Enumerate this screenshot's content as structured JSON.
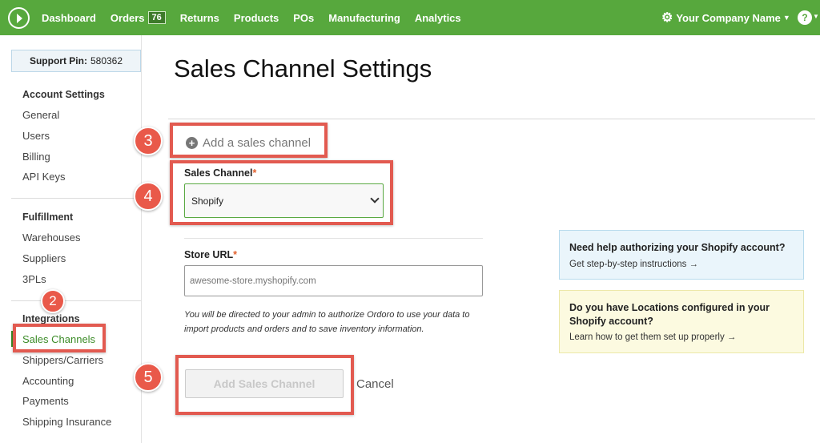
{
  "topbar": {
    "nav": [
      {
        "label": "Dashboard"
      },
      {
        "label": "Orders",
        "badge": "76"
      },
      {
        "label": "Returns"
      },
      {
        "label": "Products"
      },
      {
        "label": "POs"
      },
      {
        "label": "Manufacturing"
      },
      {
        "label": "Analytics"
      }
    ],
    "company": "Your Company Name",
    "help": "?"
  },
  "sidebar": {
    "support_pin_label": "Support Pin:",
    "support_pin_value": "580362",
    "sections": [
      {
        "title": "Account Settings",
        "items": [
          "General",
          "Users",
          "Billing",
          "API Keys"
        ]
      },
      {
        "title": "Fulfillment",
        "items": [
          "Warehouses",
          "Suppliers",
          "3PLs"
        ]
      },
      {
        "title": "Integrations",
        "items": [
          "Sales Channels",
          "Shippers/Carriers",
          "Accounting",
          "Payments",
          "Shipping Insurance"
        ]
      }
    ],
    "active_item": "Sales Channels"
  },
  "main": {
    "title": "Sales Channel Settings",
    "add_channel": "Add a sales channel",
    "sales_channel_label": "Sales Channel",
    "sales_channel_value": "Shopify",
    "required_mark": "*",
    "store_url_label": "Store URL",
    "store_url_placeholder": "awesome-store.myshopify.com",
    "help_text": "You will be directed to your admin to authorize Ordoro to use your data to import products and orders and to save inventory information.",
    "add_button": "Add Sales Channel",
    "cancel": "Cancel"
  },
  "info": {
    "blue_title": "Need help authorizing your Shopify account?",
    "blue_link": "Get step-by-step instructions →",
    "yellow_title": "Do you have Locations configured in your Shopify account?",
    "yellow_link": "Learn how to get them set up properly →"
  },
  "callouts": [
    "2",
    "3",
    "4",
    "5"
  ],
  "colors": {
    "brand_green": "#57a83d",
    "active_green": "#3c8c28",
    "callout_red": "#e25a50",
    "required_orange": "#e3622f"
  }
}
